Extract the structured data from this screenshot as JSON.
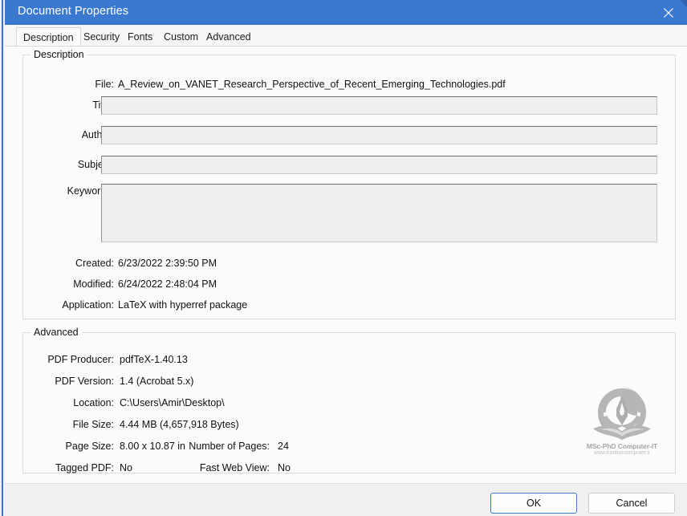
{
  "window": {
    "title": "Document Properties",
    "close_icon": "close-x-icon"
  },
  "tabs": [
    {
      "label": "Description",
      "active": true
    },
    {
      "label": "Security",
      "active": false
    },
    {
      "label": "Fonts",
      "active": false
    },
    {
      "label": "Custom",
      "active": false
    },
    {
      "label": "Advanced",
      "active": false
    }
  ],
  "description": {
    "legend": "Description",
    "file": {
      "label": "File:",
      "value": "A_Review_on_VANET_Research_Perspective_of_Recent_Emerging_Technologies.pdf"
    },
    "title": {
      "label": "Title:",
      "value": "",
      "placeholder": ""
    },
    "author": {
      "label": "Author:",
      "value": "",
      "placeholder": ""
    },
    "subject": {
      "label": "Subject:",
      "value": "",
      "placeholder": ""
    },
    "keywords": {
      "label": "Keywords:",
      "value": "",
      "placeholder": ""
    },
    "created": {
      "label": "Created:",
      "value": "6/23/2022 2:39:50 PM"
    },
    "modified": {
      "label": "Modified:",
      "value": "6/24/2022 2:48:04 PM"
    },
    "application": {
      "label": "Application:",
      "value": "LaTeX with hyperref package"
    }
  },
  "advanced": {
    "legend": "Advanced",
    "pdf_producer": {
      "label": "PDF Producer:",
      "value": "pdfTeX-1.40.13"
    },
    "pdf_version": {
      "label": "PDF Version:",
      "value": "1.4 (Acrobat 5.x)"
    },
    "location": {
      "label": "Location:",
      "value": "C:\\Users\\Amir\\Desktop\\"
    },
    "file_size": {
      "label": "File Size:",
      "value": "4.44 MB (4,657,918 Bytes)"
    },
    "page_size": {
      "label": "Page Size:",
      "value": "8.00 x 10.87 in"
    },
    "tagged_pdf": {
      "label": "Tagged PDF:",
      "value": "No"
    },
    "number_of_pages": {
      "label": "Number of Pages:",
      "value": "24"
    },
    "fast_web_view": {
      "label": "Fast Web View:",
      "value": "No"
    }
  },
  "watermark": {
    "caption": "MSc-PhD Computer-IT",
    "url": "www.konkurcomputer.ir",
    "icon": "pen-nib-book-logo-icon"
  },
  "footer": {
    "ok_label": "OK",
    "cancel_label": "Cancel"
  },
  "colors": {
    "titlebar": "#3b78cf",
    "accent": "#3b78cf",
    "dialog_bg": "#fbfbfb",
    "footer_bg": "#f0f0f0",
    "field_bg": "#efefef",
    "group_border": "#dcdcdc"
  }
}
